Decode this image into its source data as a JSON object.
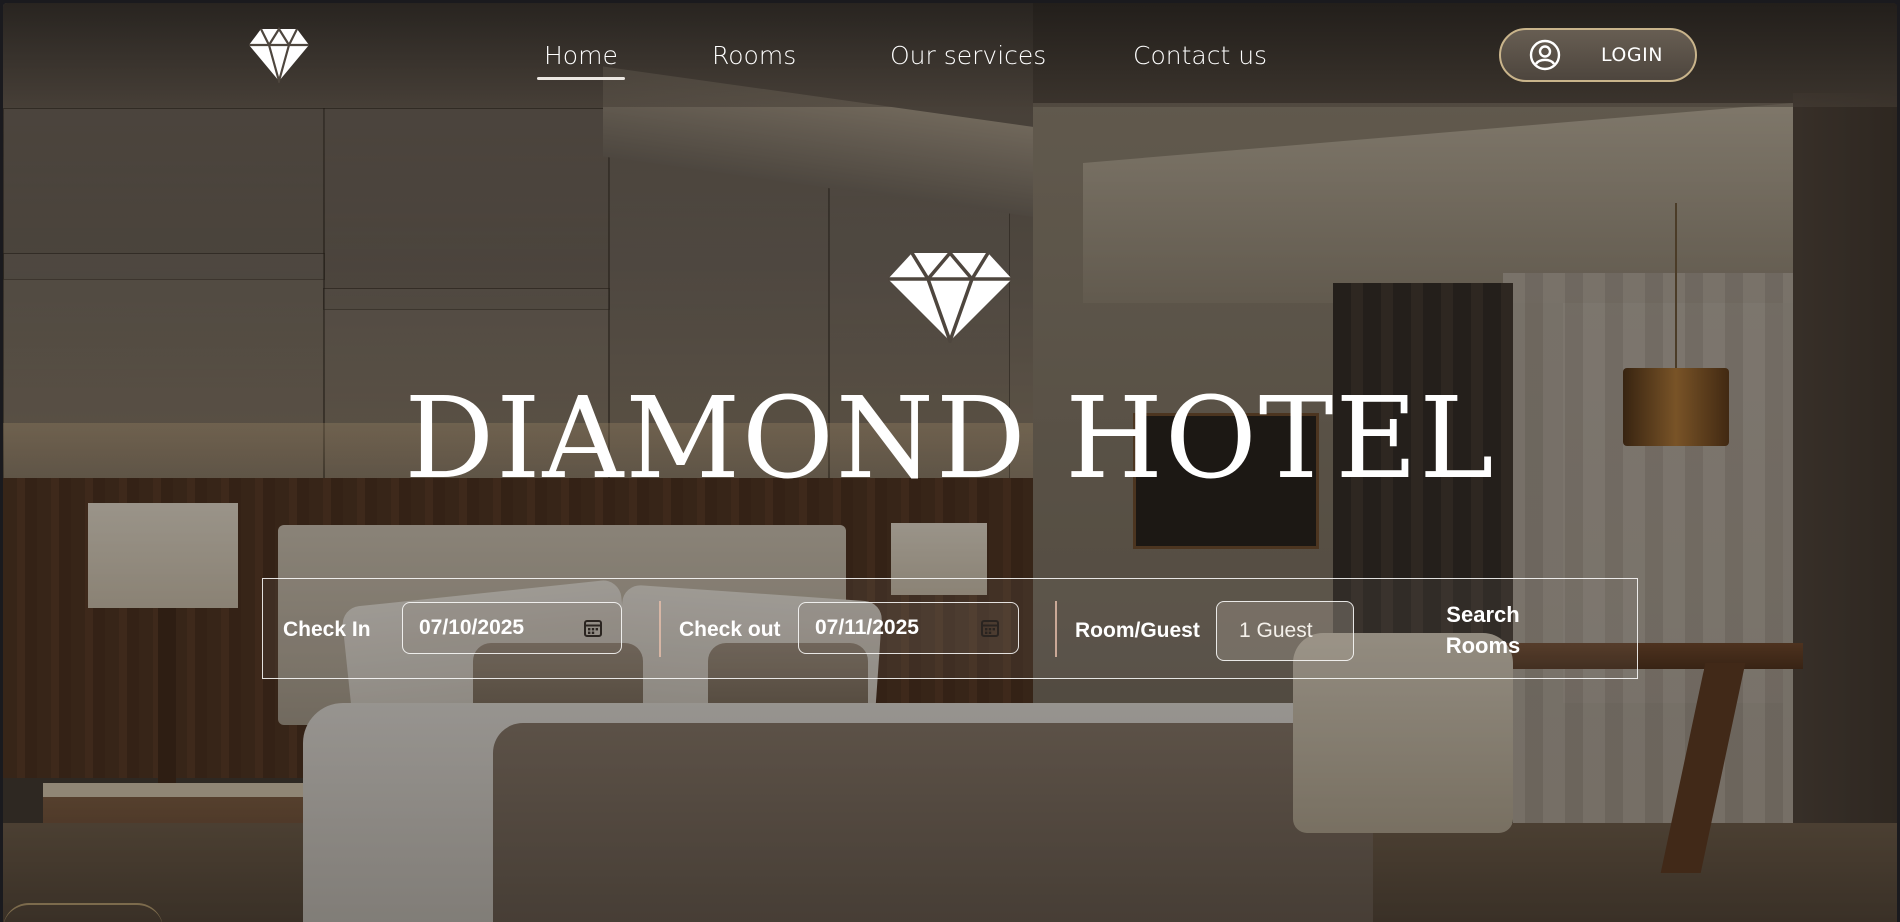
{
  "header": {
    "logo_icon": "diamond-icon",
    "nav": [
      {
        "label": "Home",
        "active": true
      },
      {
        "label": "Rooms",
        "active": false
      },
      {
        "label": "Our services",
        "active": false
      },
      {
        "label": "Contact us",
        "active": false
      }
    ],
    "login": {
      "icon": "user-circle-icon",
      "label": "LOGIN"
    }
  },
  "hero": {
    "logo_icon": "diamond-icon",
    "title": "DIAMOND HOTEL"
  },
  "booking": {
    "check_in_label": "Check In",
    "check_in_value": "07/10/2025",
    "check_out_label": "Check out",
    "check_out_value": "07/11/2025",
    "room_guest_label": "Room/Guest",
    "room_guest_value": "1 Guest",
    "search_button": "Search Rooms",
    "calendar_icon": "calendar-icon"
  },
  "colors": {
    "accent_border": "#c9b48b",
    "text": "#ffffff"
  }
}
